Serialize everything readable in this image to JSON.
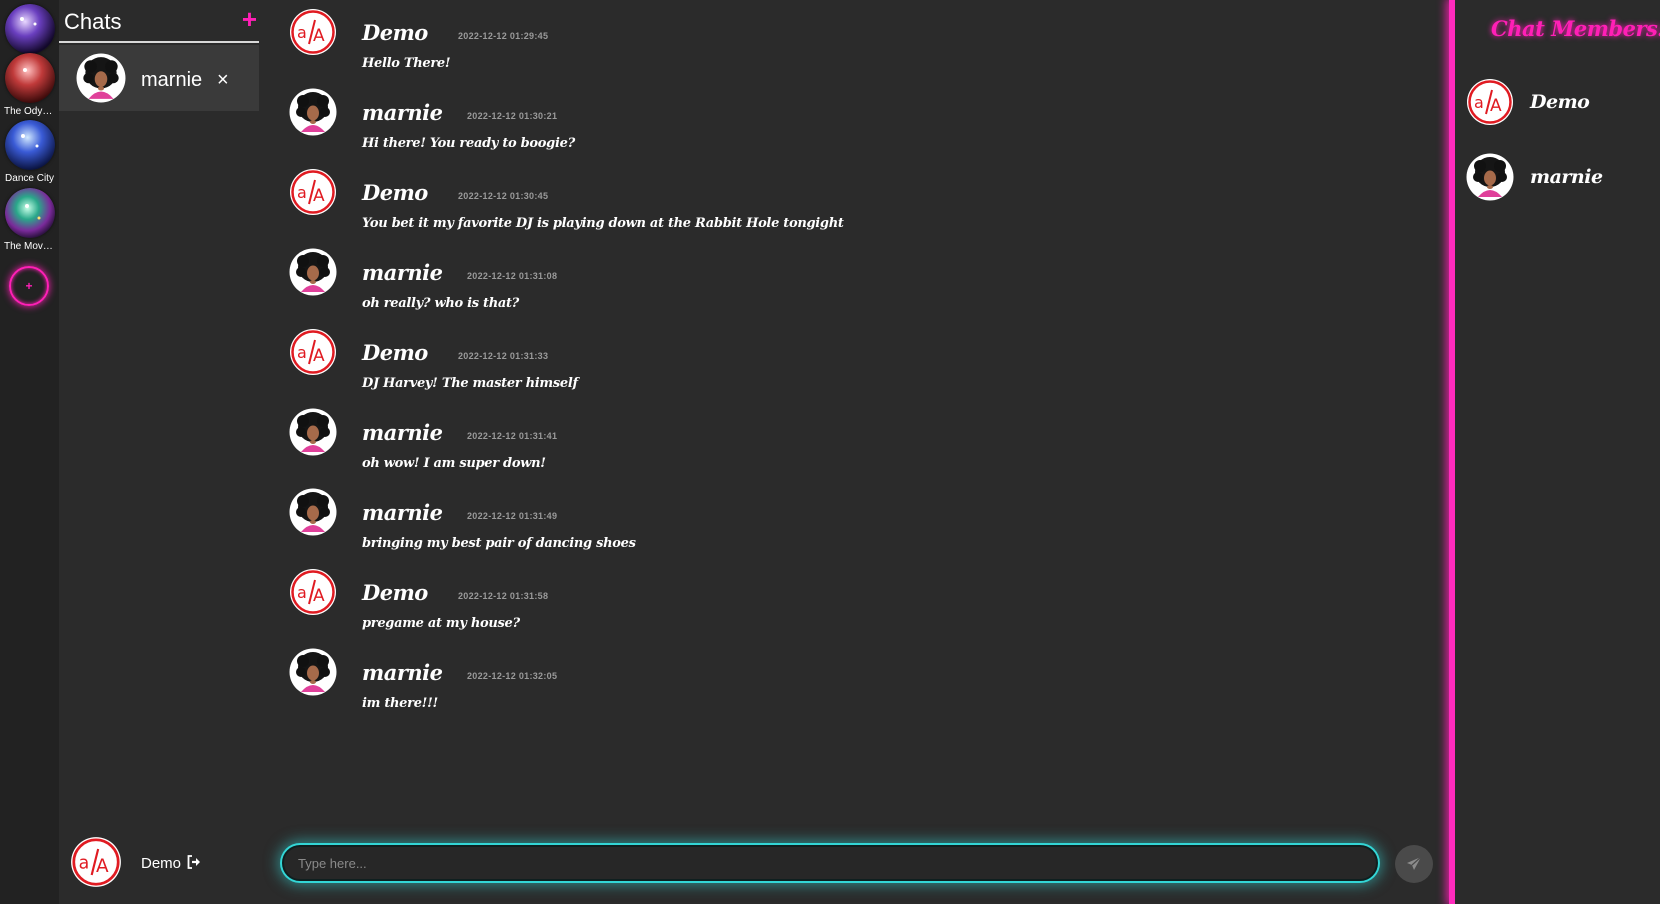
{
  "servers": [
    {
      "label": "",
      "icon": "disco-ball-purple"
    },
    {
      "label": "The Odyssey",
      "icon": "disco-ball-red"
    },
    {
      "label": "Dance City",
      "icon": "disco-ball-blue"
    },
    {
      "label": "The Movies",
      "icon": "disco-ball-green"
    }
  ],
  "add_server_label": "+",
  "chats": {
    "title": "Chats",
    "new_chat_label": "+",
    "dm": {
      "name": "marnie",
      "close_label": "×"
    }
  },
  "current_user": {
    "name": "Demo",
    "logout_icon": "logout-icon"
  },
  "messages": [
    {
      "author": "Demo",
      "time": "2022-12-12 01:29:45",
      "text": "Hello There!",
      "avatar": "aa-logo"
    },
    {
      "author": "marnie",
      "time": "2022-12-12 01:30:21",
      "text": "Hi there! You ready to boogie?",
      "avatar": "marnie-photo"
    },
    {
      "author": "Demo",
      "time": "2022-12-12 01:30:45",
      "text": "You bet it my favorite DJ is playing down at the Rabbit Hole tongight",
      "avatar": "aa-logo"
    },
    {
      "author": "marnie",
      "time": "2022-12-12 01:31:08",
      "text": "oh really? who is that?",
      "avatar": "marnie-photo"
    },
    {
      "author": "Demo",
      "time": "2022-12-12 01:31:33",
      "text": "DJ Harvey! The master himself",
      "avatar": "aa-logo"
    },
    {
      "author": "marnie",
      "time": "2022-12-12 01:31:41",
      "text": "oh wow! I am super down!",
      "avatar": "marnie-photo"
    },
    {
      "author": "marnie",
      "time": "2022-12-12 01:31:49",
      "text": "bringing my best pair of dancing shoes",
      "avatar": "marnie-photo"
    },
    {
      "author": "Demo",
      "time": "2022-12-12 01:31:58",
      "text": "pregame at my house?",
      "avatar": "aa-logo"
    },
    {
      "author": "marnie",
      "time": "2022-12-12 01:32:05",
      "text": "im there!!!",
      "avatar": "marnie-photo"
    }
  ],
  "composer": {
    "placeholder": "Type here...",
    "send_icon": "send-icon"
  },
  "members": {
    "title": "Chat Members:",
    "list": [
      {
        "name": "Demo",
        "avatar": "aa-logo"
      },
      {
        "name": "marnie",
        "avatar": "marnie-photo"
      }
    ]
  },
  "colors": {
    "background": "#2b2b2b",
    "rail": "#222222",
    "accent_pink": "#ff1fb6",
    "accent_cyan": "#33d6d6",
    "logo_red": "#e01b22",
    "timestamp": "#9a9a9a"
  }
}
